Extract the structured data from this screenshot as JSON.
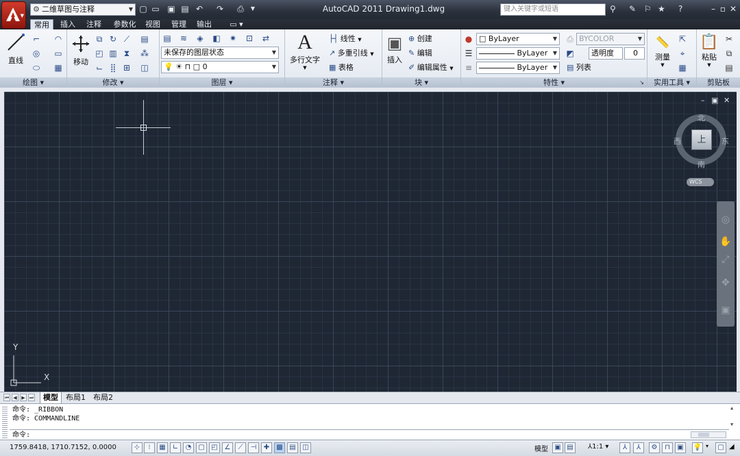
{
  "titlebar": {
    "workspace": "二维草图与注释",
    "window_title": "AutoCAD 2011    Drawing1.dwg",
    "search_placeholder": "键入关键字或短语"
  },
  "tabs": [
    "常用",
    "插入",
    "注释",
    "参数化",
    "视图",
    "管理",
    "输出"
  ],
  "active_tab": "常用",
  "ribbon": {
    "draw": {
      "title": "绘图",
      "line_label": "直线"
    },
    "modify": {
      "title": "修改",
      "move_label": "移动"
    },
    "layers": {
      "title": "图层",
      "layer_state": "未保存的图层状态",
      "current_layer": "0"
    },
    "annotation": {
      "title": "注释",
      "mtext_label": "多行文字",
      "linear": "线性",
      "multileader": "多重引线",
      "table": "表格"
    },
    "block": {
      "title": "块",
      "insert": "插入",
      "create": "创建",
      "edit": "编辑",
      "edit_attributes": "编辑属性"
    },
    "properties": {
      "title": "特性",
      "color": "ByLayer",
      "linetype": "ByLayer",
      "lineweight": "ByLayer",
      "plotstyle": "BYCOLOR",
      "transparency_label": "透明度",
      "transparency_value": "0",
      "list_label": "列表"
    },
    "utilities": {
      "title": "实用工具",
      "measure": "测量"
    },
    "clipboard": {
      "title": "剪贴板",
      "paste": "粘贴"
    }
  },
  "viewport": {
    "compass": {
      "north": "北",
      "south": "南",
      "east": "东",
      "west": "西",
      "top_face": "上"
    },
    "wcs": "WCS",
    "ucs": {
      "x": "X",
      "y": "Y"
    }
  },
  "layout_tabs": [
    "模型",
    "布局1",
    "布局2"
  ],
  "active_layout": "模型",
  "command": {
    "history": [
      "命令: _RIBBON",
      "命令: COMMANDLINE"
    ],
    "prompt": "命令:"
  },
  "statusbar": {
    "coordinates": "1759.8418,  1710.7152,  0.0000",
    "model_label": "模型",
    "annotation_scale": "1:1"
  }
}
